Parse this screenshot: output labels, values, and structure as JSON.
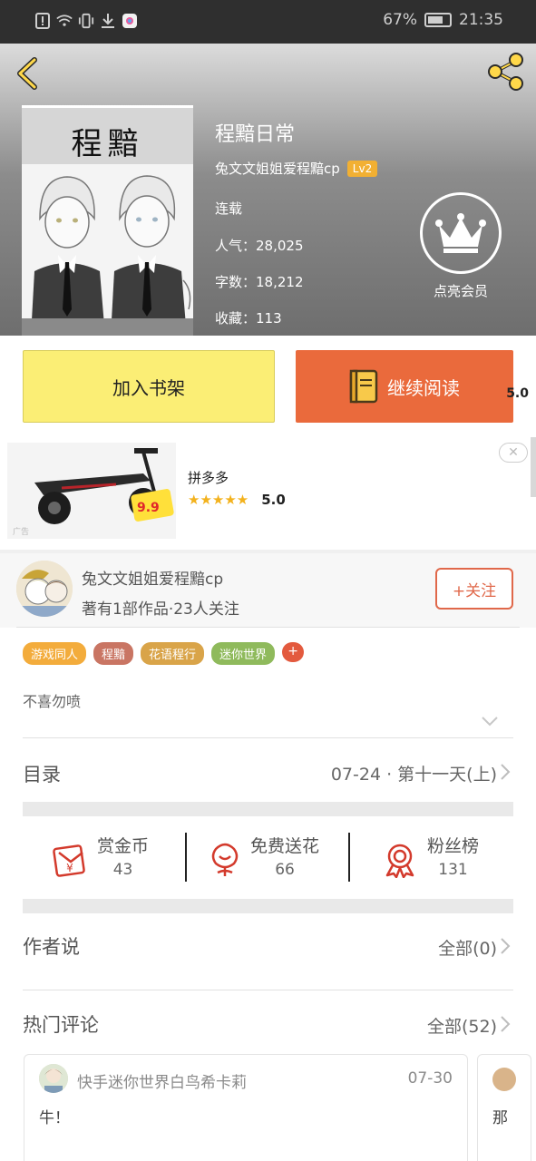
{
  "status_bar": {
    "battery": "67%",
    "time": "21:35"
  },
  "book": {
    "cover_title": "程黯",
    "title": "程黯日常",
    "author": "兔文文姐姐爱程黯cp",
    "level": "Lv2",
    "status": "连载",
    "popularity": "人气：28,025",
    "word_count": "字数：18,212",
    "favorites": "收藏：113",
    "vip_label": "点亮会员"
  },
  "actions": {
    "shelf_label": "加入书架",
    "read_label": "继续阅读",
    "side_score": "5.0"
  },
  "ad": {
    "name": "拼多多",
    "score": "5.0",
    "tag": "广告",
    "close": "✕",
    "stars": "★★★★★",
    "badge": "9.9"
  },
  "author_block": {
    "name": "兔文文姐姐爱程黯cp",
    "stats": "著有1部作品·23人关注",
    "follow_label": "+关注"
  },
  "tags": [
    {
      "label": "游戏同人",
      "color": "#f3ac3c"
    },
    {
      "label": "程黯",
      "color": "#c97563"
    },
    {
      "label": "花语程行",
      "color": "#d9a449"
    },
    {
      "label": "迷你世界",
      "color": "#8fba5c"
    }
  ],
  "tag_add": "+",
  "intro": "不喜勿喷",
  "toc": {
    "title": "目录",
    "latest": "07-24 · 第十一天(上)"
  },
  "stats": [
    {
      "label": "赏金币",
      "value": "43",
      "icon": "coin-envelope-icon"
    },
    {
      "label": "免费送花",
      "value": "66",
      "icon": "flower-icon"
    },
    {
      "label": "粉丝榜",
      "value": "131",
      "icon": "medal-icon"
    }
  ],
  "author_says": {
    "title": "作者说",
    "all": "全部(0)"
  },
  "hot_comments": {
    "title": "热门评论",
    "all": "全部(52)"
  },
  "comments": [
    {
      "user": "快手迷你世界白鸟希卡莉",
      "date": "07-30",
      "text": "牛！"
    },
    {
      "text": "那"
    }
  ],
  "colors": {
    "accent_orange": "#ea6a3c",
    "shelf_yellow": "#fbee75",
    "follow_red": "#e0684a"
  }
}
